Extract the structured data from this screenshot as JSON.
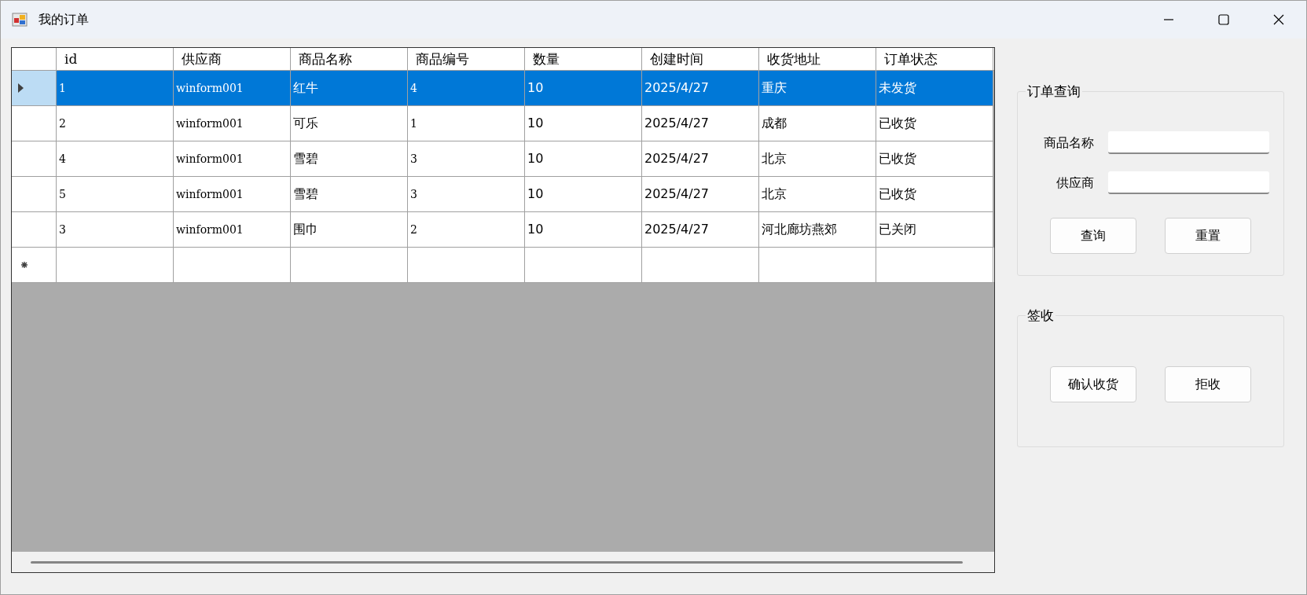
{
  "window": {
    "title": "我的订单"
  },
  "table": {
    "columns": [
      "id",
      "供应商",
      "商品名称",
      "商品编号",
      "数量",
      "创建时间",
      "收货地址",
      "订单状态"
    ],
    "rows": [
      {
        "selected": true,
        "cells": [
          "1",
          "winform001",
          "红牛",
          "4",
          "10",
          "2025/4/27",
          "重庆",
          "未发货"
        ]
      },
      {
        "selected": false,
        "cells": [
          "2",
          "winform001",
          "可乐",
          "1",
          "10",
          "2025/4/27",
          "成都",
          "已收货"
        ]
      },
      {
        "selected": false,
        "cells": [
          "4",
          "winform001",
          "雪碧",
          "3",
          "10",
          "2025/4/27",
          "北京",
          "已收货"
        ]
      },
      {
        "selected": false,
        "cells": [
          "5",
          "winform001",
          "雪碧",
          "3",
          "10",
          "2025/4/27",
          "北京",
          "已收货"
        ]
      },
      {
        "selected": false,
        "cells": [
          "3",
          "winform001",
          "围巾",
          "2",
          "10",
          "2025/4/27",
          "河北廊坊燕郊",
          "已关闭"
        ]
      }
    ],
    "new_row": true
  },
  "query_group": {
    "title": "订单查询",
    "fields": [
      {
        "label": "商品名称"
      },
      {
        "label": "供应商"
      }
    ],
    "buttons": [
      "查询",
      "重置"
    ]
  },
  "receipt_group": {
    "title": "签收",
    "buttons": [
      "确认收货",
      "拒收"
    ]
  }
}
